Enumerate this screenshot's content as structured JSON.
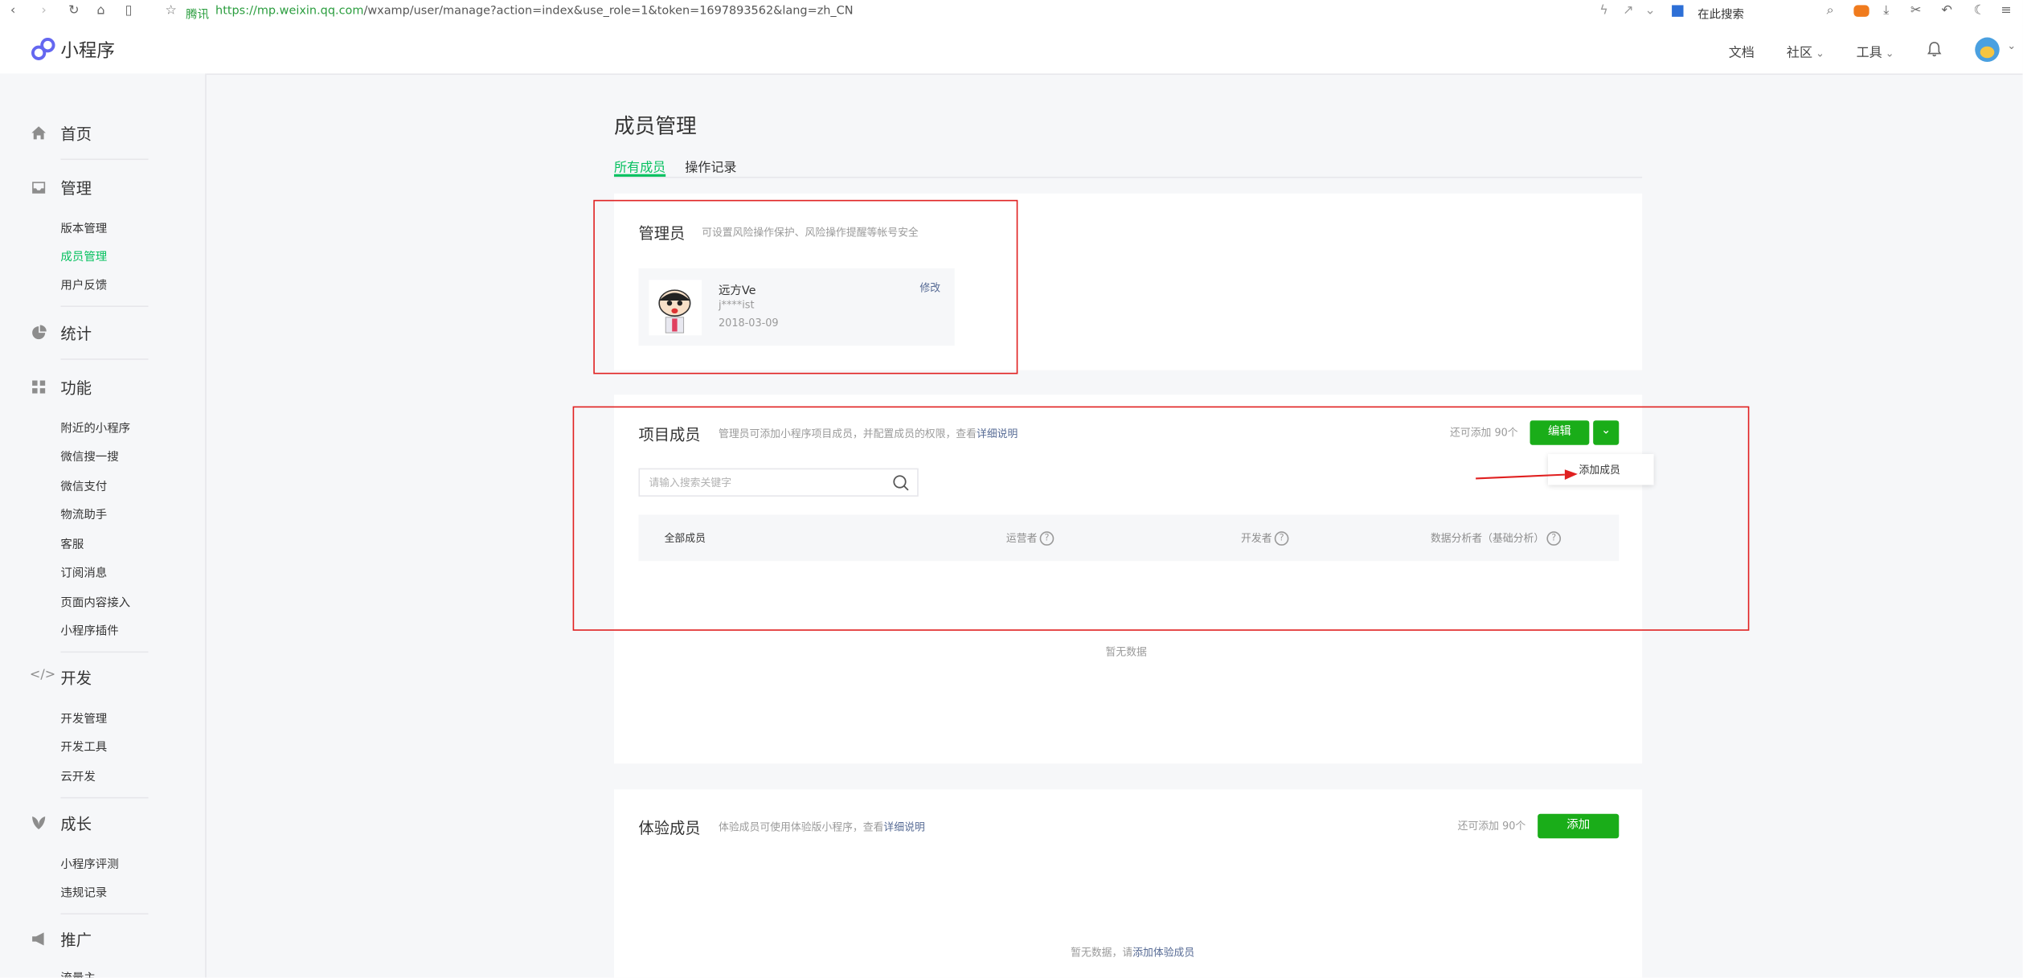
{
  "browser": {
    "tencent_label": "腾讯",
    "url_host": "https://mp.weixin.qq.com",
    "url_path": "/wxamp/user/manage?action=index&use_role=1&token=1697893562&lang=zh_CN",
    "search_placeholder": "在此搜索"
  },
  "topnav": {
    "logo_text": "小程序",
    "links": [
      "文档",
      "社区",
      "工具"
    ]
  },
  "sidebar": {
    "sections": [
      {
        "title": "首页",
        "icon": "home-icon",
        "items": []
      },
      {
        "title": "管理",
        "icon": "inbox-icon",
        "items": [
          "版本管理",
          "成员管理",
          "用户反馈"
        ]
      },
      {
        "title": "统计",
        "icon": "pie-chart-icon",
        "items": []
      },
      {
        "title": "功能",
        "icon": "grid-icon",
        "items": [
          "附近的小程序",
          "微信搜一搜",
          "微信支付",
          "物流助手",
          "客服",
          "订阅消息",
          "页面内容接入",
          "小程序插件"
        ]
      },
      {
        "title": "开发",
        "icon": "code-icon",
        "items": [
          "开发管理",
          "开发工具",
          "云开发"
        ]
      },
      {
        "title": "成长",
        "icon": "leaf-icon",
        "items": [
          "小程序评测",
          "违规记录"
        ]
      },
      {
        "title": "推广",
        "icon": "megaphone-icon",
        "items": [
          "流量主"
        ]
      }
    ],
    "active_item": "成员管理"
  },
  "page": {
    "title": "成员管理",
    "tabs": [
      "所有成员",
      "操作记录"
    ],
    "active_tab": "所有成员"
  },
  "admin": {
    "title": "管理员",
    "desc": "可设置风险操作保护、风险操作提醒等帐号安全",
    "name": "远方Ve",
    "account": "j****ist",
    "date": "2018-03-09",
    "edit": "修改"
  },
  "project": {
    "title": "项目成员",
    "desc": "管理员可添加小程序项目成员，并配置成员的权限，查看",
    "desc_link": "详细说明",
    "quota": "还可添加 90个",
    "edit_btn": "编辑",
    "dropdown_item": "添加成员",
    "search_placeholder": "请输入搜索关键字",
    "columns": [
      "全部成员",
      "运营者",
      "开发者",
      "数据分析者（基础分析）"
    ],
    "empty": "暂无数据"
  },
  "trial": {
    "title": "体验成员",
    "desc": "体验成员可使用体验版小程序，查看",
    "desc_link": "详细说明",
    "quota": "还可添加 90个",
    "add_btn": "添加",
    "empty_prefix": "暂无数据，请",
    "empty_link": "添加体验成员"
  },
  "colors": {
    "accent_green": "#07c160",
    "button_green": "#1aad19",
    "link_blue": "#576b95",
    "annotation_red": "#e02020"
  }
}
